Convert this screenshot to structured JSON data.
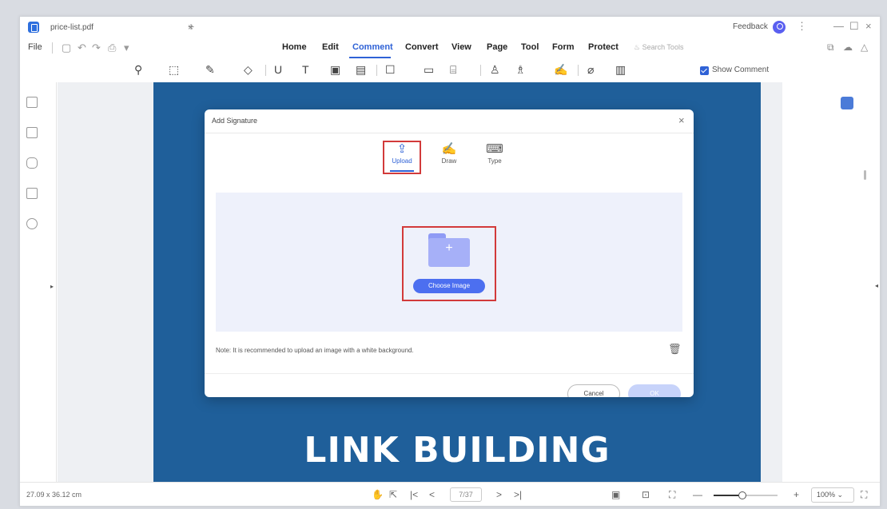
{
  "titlebar": {
    "tab_title": "price-list.pdf",
    "tab_close": "×",
    "tab_add": "+",
    "feedback": "Feedback",
    "more": "⋮",
    "minimize": "—",
    "maximize": "☐",
    "close": "×"
  },
  "menubar": {
    "file": "File",
    "items": [
      "Home",
      "Edit",
      "Comment",
      "Convert",
      "View",
      "Page",
      "Tool",
      "Form",
      "Protect"
    ],
    "active": "Comment",
    "search_placeholder": "Search Tools"
  },
  "toolbar": {
    "show_comment": "Show Comment",
    "show_comment_checked": true
  },
  "document": {
    "headline": "LINK BUILDING",
    "page_color": "#1f5f9a"
  },
  "statusbar": {
    "dimensions": "27.09 x 36.12 cm",
    "page_indicator": "7/37",
    "zoom": "100%",
    "zoom_fraction": 0.45
  },
  "modal": {
    "title": "Add Signature",
    "close": "×",
    "tabs": [
      {
        "label": "Upload",
        "icon": "upload-icon"
      },
      {
        "label": "Draw",
        "icon": "draw-icon"
      },
      {
        "label": "Type",
        "icon": "type-icon"
      }
    ],
    "active_tab": "Upload",
    "choose_image": "Choose Image",
    "note": "Note: It is recommended to upload an image with a white background.",
    "cancel": "Cancel",
    "ok": "OK"
  },
  "colors": {
    "accent": "#2f62d6",
    "highlight": "#d23a3a",
    "button": "#4c6ff0"
  }
}
